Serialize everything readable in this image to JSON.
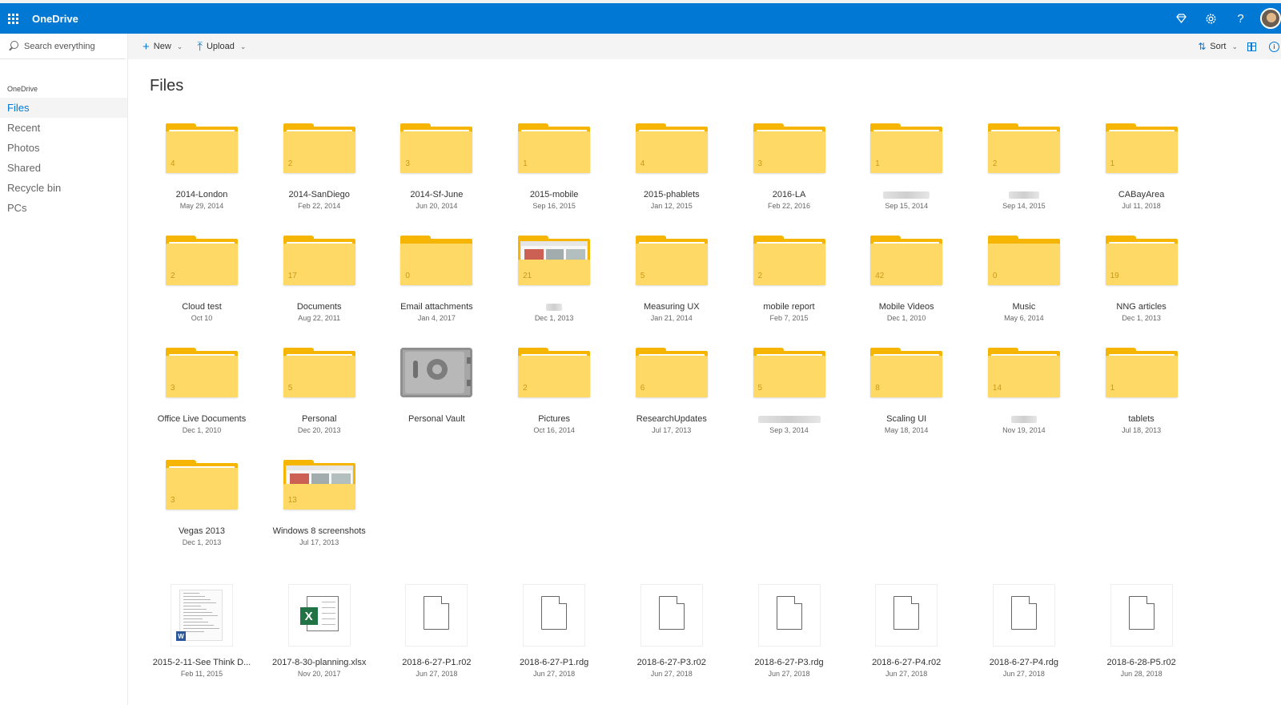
{
  "app": {
    "name": "OneDrive"
  },
  "search": {
    "placeholder": "Search everything"
  },
  "nav": {
    "heading": "OneDrive",
    "items": [
      {
        "label": "Files",
        "active": true
      },
      {
        "label": "Recent"
      },
      {
        "label": "Photos"
      },
      {
        "label": "Shared"
      },
      {
        "label": "Recycle bin"
      },
      {
        "label": "PCs"
      }
    ]
  },
  "commands": {
    "new": "New",
    "upload": "Upload",
    "sort": "Sort"
  },
  "icons": {
    "suite": [
      "diamond-icon",
      "gear-icon",
      "help-icon"
    ],
    "colors": {
      "brand": "#0078d4",
      "folder_front": "#ffd966",
      "folder_back": "#f5b500"
    }
  },
  "page_title": "Files",
  "folders": [
    {
      "name": "2014-London",
      "date": "May 29, 2014",
      "count": "4"
    },
    {
      "name": "2014-SanDiego",
      "date": "Feb 22, 2014",
      "count": "2"
    },
    {
      "name": "2014-Sf-June",
      "date": "Jun 20, 2014",
      "count": "3"
    },
    {
      "name": "2015-mobile",
      "date": "Sep 16, 2015",
      "count": "1"
    },
    {
      "name": "2015-phablets",
      "date": "Jan 12, 2015",
      "count": "4"
    },
    {
      "name": "2016-LA",
      "date": "Feb 22, 2016",
      "count": "3"
    },
    {
      "name": "",
      "date": "Sep 15, 2014",
      "count": "1",
      "redacted": true
    },
    {
      "name": "",
      "date": "Sep 14, 2015",
      "count": "2",
      "redacted": true
    },
    {
      "name": "CABayArea",
      "date": "Jul 11, 2018",
      "count": "1"
    },
    {
      "name": "Cloud test",
      "date": "Oct 10",
      "count": "2"
    },
    {
      "name": "Documents",
      "date": "Aug 22, 2011",
      "count": "17"
    },
    {
      "name": "Email attachments",
      "date": "Jan 4, 2017",
      "count": "0",
      "empty": true
    },
    {
      "name": "",
      "date": "Dec 1, 2013",
      "count": "21",
      "redacted": true,
      "thumb": true
    },
    {
      "name": "Measuring UX",
      "date": "Jan 21, 2014",
      "count": "5"
    },
    {
      "name": "mobile report",
      "date": "Feb 7, 2015",
      "count": "2"
    },
    {
      "name": "Mobile Videos",
      "date": "Dec 1, 2010",
      "count": "42"
    },
    {
      "name": "Music",
      "date": "May 6, 2014",
      "count": "0",
      "empty": true
    },
    {
      "name": "NNG articles",
      "date": "Dec 1, 2013",
      "count": "19"
    },
    {
      "name": "Office Live Documents",
      "date": "Dec 1, 2010",
      "count": "3"
    },
    {
      "name": "Personal",
      "date": "Dec 20, 2013",
      "count": "5"
    },
    {
      "name": "Personal Vault",
      "date": "",
      "count": "",
      "vault": true
    },
    {
      "name": "Pictures",
      "date": "Oct 16, 2014",
      "count": "2"
    },
    {
      "name": "ResearchUpdates",
      "date": "Jul 17, 2013",
      "count": "6"
    },
    {
      "name": "",
      "date": "Sep 3, 2014",
      "count": "5",
      "redacted": true
    },
    {
      "name": "Scaling UI",
      "date": "May 18, 2014",
      "count": "8"
    },
    {
      "name": "",
      "date": "Nov 19, 2014",
      "count": "14",
      "redacted": true
    },
    {
      "name": "tablets",
      "date": "Jul 18, 2013",
      "count": "1"
    },
    {
      "name": "Vegas 2013",
      "date": "Dec 1, 2013",
      "count": "3"
    },
    {
      "name": "Windows 8 screenshots",
      "date": "Jul 17, 2013",
      "count": "13",
      "thumb": true
    }
  ],
  "files": [
    {
      "name": "2015-2-11-See Think D...",
      "date": "Feb 11, 2015",
      "kind": "word"
    },
    {
      "name": "2017-8-30-planning.xlsx",
      "date": "Nov 20, 2017",
      "kind": "excel"
    },
    {
      "name": "2018-6-27-P1.r02",
      "date": "Jun 27, 2018",
      "kind": "generic"
    },
    {
      "name": "2018-6-27-P1.rdg",
      "date": "Jun 27, 2018",
      "kind": "generic"
    },
    {
      "name": "2018-6-27-P3.r02",
      "date": "Jun 27, 2018",
      "kind": "generic"
    },
    {
      "name": "2018-6-27-P3.rdg",
      "date": "Jun 27, 2018",
      "kind": "generic"
    },
    {
      "name": "2018-6-27-P4.r02",
      "date": "Jun 27, 2018",
      "kind": "generic"
    },
    {
      "name": "2018-6-27-P4.rdg",
      "date": "Jun 27, 2018",
      "kind": "generic"
    },
    {
      "name": "2018-6-28-P5.r02",
      "date": "Jun 28, 2018",
      "kind": "generic"
    }
  ]
}
